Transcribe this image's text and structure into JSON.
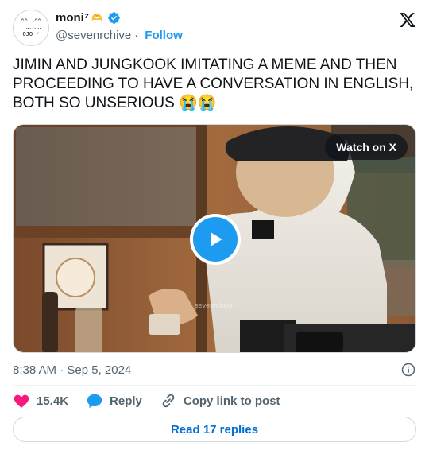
{
  "author": {
    "display_name": "moni⁷",
    "display_name_emoji": "🫶",
    "handle": "@sevenrchive",
    "separator": "·",
    "follow_label": "Follow",
    "avatar_text": "^^  ^^\n ᴗᴗ ᴗᴗ\nOJO ᵛ"
  },
  "tweet": {
    "text": "JIMIN AND JUNGKOOK IMITATING A MEME AND THEN PROCEEDING TO HAVE A CONVERSATION IN ENGLISH, BOTH SO UNSERIOUS 😭😭"
  },
  "media": {
    "watch_label": "Watch on X",
    "watermark": "sevenrchive"
  },
  "meta": {
    "timestamp": "8:38 AM · Sep 5, 2024"
  },
  "actions": {
    "likes": "15.4K",
    "reply_label": "Reply",
    "copy_label": "Copy link to post"
  },
  "footer": {
    "read_replies_label": "Read 17 replies"
  },
  "colors": {
    "accent": "#1d9bf0",
    "like": "#f91880",
    "link": "#006fd6",
    "muted": "#536471"
  },
  "icons": [
    "verified-badge-icon",
    "x-logo-icon",
    "play-icon",
    "info-icon",
    "heart-icon",
    "reply-bubble-icon",
    "link-icon"
  ]
}
